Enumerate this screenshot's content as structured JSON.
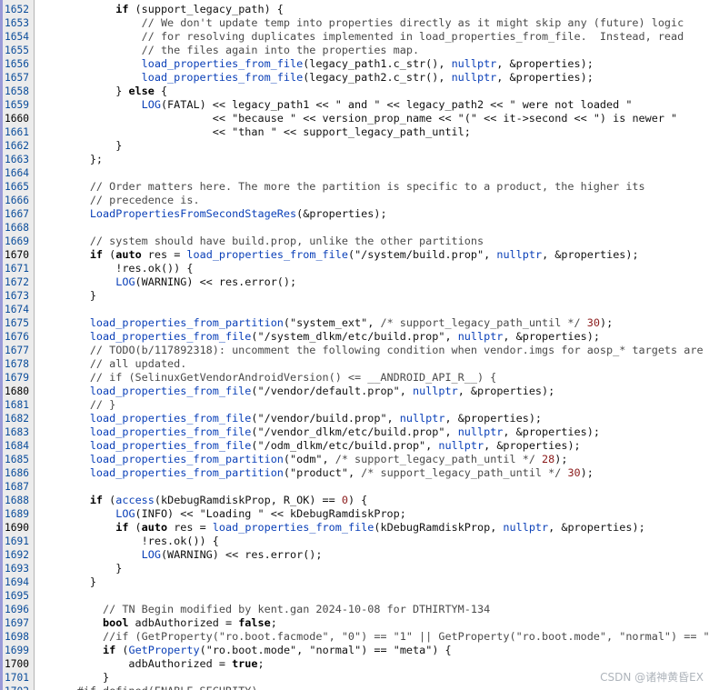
{
  "editor": {
    "lines": [
      {
        "n": "1651",
        "tokens": []
      },
      {
        "n": "1652",
        "tokens": [
          {
            "t": "            "
          },
          {
            "t": "if",
            "c": "kw"
          },
          {
            "t": " (support_legacy_path) {"
          }
        ]
      },
      {
        "n": "1653",
        "tokens": [
          {
            "t": "                "
          },
          {
            "t": "// We don't update temp into properties directly as it might skip any (future) logic",
            "c": "cm"
          }
        ]
      },
      {
        "n": "1654",
        "tokens": [
          {
            "t": "                "
          },
          {
            "t": "// for resolving duplicates implemented in load_properties_from_file.  Instead, read",
            "c": "cm"
          }
        ]
      },
      {
        "n": "1655",
        "tokens": [
          {
            "t": "                "
          },
          {
            "t": "// the files again into the properties map.",
            "c": "cm"
          }
        ]
      },
      {
        "n": "1656",
        "tokens": [
          {
            "t": "                "
          },
          {
            "t": "load_properties_from_file",
            "c": "fn"
          },
          {
            "t": "(legacy_path1.c_str(), "
          },
          {
            "t": "nullptr",
            "c": "fn"
          },
          {
            "t": ", &properties);"
          }
        ]
      },
      {
        "n": "1657",
        "tokens": [
          {
            "t": "                "
          },
          {
            "t": "load_properties_from_file",
            "c": "fn"
          },
          {
            "t": "(legacy_path2.c_str(), "
          },
          {
            "t": "nullptr",
            "c": "fn"
          },
          {
            "t": ", &properties);"
          }
        ]
      },
      {
        "n": "1658",
        "tokens": [
          {
            "t": "            } "
          },
          {
            "t": "else",
            "c": "kw"
          },
          {
            "t": " {"
          }
        ]
      },
      {
        "n": "1659",
        "tokens": [
          {
            "t": "                "
          },
          {
            "t": "LOG",
            "c": "fn"
          },
          {
            "t": "(FATAL) << legacy_path1 << "
          },
          {
            "t": "\" and \"",
            "c": "str"
          },
          {
            "t": " << legacy_path2 << "
          },
          {
            "t": "\" were not loaded \"",
            "c": "str"
          }
        ]
      },
      {
        "n": "1660",
        "cur": true,
        "tokens": [
          {
            "t": "                           << "
          },
          {
            "t": "\"because \"",
            "c": "str"
          },
          {
            "t": " << version_prop_name << "
          },
          {
            "t": "\"(\"",
            "c": "str"
          },
          {
            "t": " << it->second << "
          },
          {
            "t": "\") is newer \"",
            "c": "str"
          }
        ]
      },
      {
        "n": "1661",
        "tokens": [
          {
            "t": "                           << "
          },
          {
            "t": "\"than \"",
            "c": "str"
          },
          {
            "t": " << support_legacy_path_until;"
          }
        ]
      },
      {
        "n": "1662",
        "tokens": [
          {
            "t": "            }"
          }
        ]
      },
      {
        "n": "1663",
        "tokens": [
          {
            "t": "        };"
          }
        ]
      },
      {
        "n": "1664",
        "tokens": []
      },
      {
        "n": "1665",
        "tokens": [
          {
            "t": "        "
          },
          {
            "t": "// Order matters here. The more the partition is specific to a product, the higher its",
            "c": "cm"
          }
        ]
      },
      {
        "n": "1666",
        "tokens": [
          {
            "t": "        "
          },
          {
            "t": "// precedence is.",
            "c": "cm"
          }
        ]
      },
      {
        "n": "1667",
        "tokens": [
          {
            "t": "        "
          },
          {
            "t": "LoadPropertiesFromSecondStageRes",
            "c": "fn"
          },
          {
            "t": "(&properties);"
          }
        ]
      },
      {
        "n": "1668",
        "tokens": []
      },
      {
        "n": "1669",
        "tokens": [
          {
            "t": "        "
          },
          {
            "t": "// system should have build.prop, unlike the other partitions",
            "c": "cm"
          }
        ]
      },
      {
        "n": "1670",
        "cur": true,
        "tokens": [
          {
            "t": "        "
          },
          {
            "t": "if",
            "c": "kw"
          },
          {
            "t": " ("
          },
          {
            "t": "auto",
            "c": "kw"
          },
          {
            "t": " res = "
          },
          {
            "t": "load_properties_from_file",
            "c": "fn"
          },
          {
            "t": "("
          },
          {
            "t": "\"/system/build.prop\"",
            "c": "str"
          },
          {
            "t": ", "
          },
          {
            "t": "nullptr",
            "c": "fn"
          },
          {
            "t": ", &properties);"
          }
        ]
      },
      {
        "n": "1671",
        "tokens": [
          {
            "t": "            !res.ok()) {"
          }
        ]
      },
      {
        "n": "1672",
        "tokens": [
          {
            "t": "            "
          },
          {
            "t": "LOG",
            "c": "fn"
          },
          {
            "t": "(WARNING) << res.error();"
          }
        ]
      },
      {
        "n": "1673",
        "tokens": [
          {
            "t": "        }"
          }
        ]
      },
      {
        "n": "1674",
        "tokens": []
      },
      {
        "n": "1675",
        "tokens": [
          {
            "t": "        "
          },
          {
            "t": "load_properties_from_partition",
            "c": "fn"
          },
          {
            "t": "("
          },
          {
            "t": "\"system_ext\"",
            "c": "str"
          },
          {
            "t": ", "
          },
          {
            "t": "/* support_legacy_path_until */",
            "c": "cm"
          },
          {
            "t": " "
          },
          {
            "t": "30",
            "c": "num"
          },
          {
            "t": ");"
          }
        ]
      },
      {
        "n": "1676",
        "tokens": [
          {
            "t": "        "
          },
          {
            "t": "load_properties_from_file",
            "c": "fn"
          },
          {
            "t": "("
          },
          {
            "t": "\"/system_dlkm/etc/build.prop\"",
            "c": "str"
          },
          {
            "t": ", "
          },
          {
            "t": "nullptr",
            "c": "fn"
          },
          {
            "t": ", &properties);"
          }
        ]
      },
      {
        "n": "1677",
        "tokens": [
          {
            "t": "        "
          },
          {
            "t": "// TODO(b/117892318): uncomment the following condition when vendor.imgs for aosp_* targets are",
            "c": "cm"
          }
        ]
      },
      {
        "n": "1678",
        "tokens": [
          {
            "t": "        "
          },
          {
            "t": "// all updated.",
            "c": "cm"
          }
        ]
      },
      {
        "n": "1679",
        "tokens": [
          {
            "t": "        "
          },
          {
            "t": "// if (SelinuxGetVendorAndroidVersion() <= __ANDROID_API_R__) {",
            "c": "cm"
          }
        ]
      },
      {
        "n": "1680",
        "cur": true,
        "tokens": [
          {
            "t": "        "
          },
          {
            "t": "load_properties_from_file",
            "c": "fn"
          },
          {
            "t": "("
          },
          {
            "t": "\"/vendor/default.prop\"",
            "c": "str"
          },
          {
            "t": ", "
          },
          {
            "t": "nullptr",
            "c": "fn"
          },
          {
            "t": ", &properties);"
          }
        ]
      },
      {
        "n": "1681",
        "tokens": [
          {
            "t": "        "
          },
          {
            "t": "// }",
            "c": "cm"
          }
        ]
      },
      {
        "n": "1682",
        "tokens": [
          {
            "t": "        "
          },
          {
            "t": "load_properties_from_file",
            "c": "fn"
          },
          {
            "t": "("
          },
          {
            "t": "\"/vendor/build.prop\"",
            "c": "str"
          },
          {
            "t": ", "
          },
          {
            "t": "nullptr",
            "c": "fn"
          },
          {
            "t": ", &properties);"
          }
        ]
      },
      {
        "n": "1683",
        "tokens": [
          {
            "t": "        "
          },
          {
            "t": "load_properties_from_file",
            "c": "fn"
          },
          {
            "t": "("
          },
          {
            "t": "\"/vendor_dlkm/etc/build.prop\"",
            "c": "str"
          },
          {
            "t": ", "
          },
          {
            "t": "nullptr",
            "c": "fn"
          },
          {
            "t": ", &properties);"
          }
        ]
      },
      {
        "n": "1684",
        "tokens": [
          {
            "t": "        "
          },
          {
            "t": "load_properties_from_file",
            "c": "fn"
          },
          {
            "t": "("
          },
          {
            "t": "\"/odm_dlkm/etc/build.prop\"",
            "c": "str"
          },
          {
            "t": ", "
          },
          {
            "t": "nullptr",
            "c": "fn"
          },
          {
            "t": ", &properties);"
          }
        ]
      },
      {
        "n": "1685",
        "tokens": [
          {
            "t": "        "
          },
          {
            "t": "load_properties_from_partition",
            "c": "fn"
          },
          {
            "t": "("
          },
          {
            "t": "\"odm\"",
            "c": "str"
          },
          {
            "t": ", "
          },
          {
            "t": "/* support_legacy_path_until */",
            "c": "cm"
          },
          {
            "t": " "
          },
          {
            "t": "28",
            "c": "num"
          },
          {
            "t": ");"
          }
        ]
      },
      {
        "n": "1686",
        "tokens": [
          {
            "t": "        "
          },
          {
            "t": "load_properties_from_partition",
            "c": "fn"
          },
          {
            "t": "("
          },
          {
            "t": "\"product\"",
            "c": "str"
          },
          {
            "t": ", "
          },
          {
            "t": "/* support_legacy_path_until */",
            "c": "cm"
          },
          {
            "t": " "
          },
          {
            "t": "30",
            "c": "num"
          },
          {
            "t": ");"
          }
        ]
      },
      {
        "n": "1687",
        "tokens": []
      },
      {
        "n": "1688",
        "tokens": [
          {
            "t": "        "
          },
          {
            "t": "if",
            "c": "kw"
          },
          {
            "t": " ("
          },
          {
            "t": "access",
            "c": "fn"
          },
          {
            "t": "(kDebugRamdiskProp, R_OK) == "
          },
          {
            "t": "0",
            "c": "num"
          },
          {
            "t": ") {"
          }
        ]
      },
      {
        "n": "1689",
        "tokens": [
          {
            "t": "            "
          },
          {
            "t": "LOG",
            "c": "fn"
          },
          {
            "t": "(INFO) << "
          },
          {
            "t": "\"Loading \"",
            "c": "str"
          },
          {
            "t": " << kDebugRamdiskProp;"
          }
        ]
      },
      {
        "n": "1690",
        "cur": true,
        "tokens": [
          {
            "t": "            "
          },
          {
            "t": "if",
            "c": "kw"
          },
          {
            "t": " ("
          },
          {
            "t": "auto",
            "c": "kw"
          },
          {
            "t": " res = "
          },
          {
            "t": "load_properties_from_file",
            "c": "fn"
          },
          {
            "t": "(kDebugRamdiskProp, "
          },
          {
            "t": "nullptr",
            "c": "fn"
          },
          {
            "t": ", &properties);"
          }
        ]
      },
      {
        "n": "1691",
        "tokens": [
          {
            "t": "                !res.ok()) {"
          }
        ]
      },
      {
        "n": "1692",
        "tokens": [
          {
            "t": "                "
          },
          {
            "t": "LOG",
            "c": "fn"
          },
          {
            "t": "(WARNING) << res.error();"
          }
        ]
      },
      {
        "n": "1693",
        "tokens": [
          {
            "t": "            }"
          }
        ]
      },
      {
        "n": "1694",
        "tokens": [
          {
            "t": "        }"
          }
        ]
      },
      {
        "n": "1695",
        "tokens": []
      },
      {
        "n": "1696",
        "tokens": [
          {
            "t": "          "
          },
          {
            "t": "// TN Begin modified by kent.gan 2024-10-08 for DTHIRTYM-134",
            "c": "cm"
          }
        ]
      },
      {
        "n": "1697",
        "tokens": [
          {
            "t": "          "
          },
          {
            "t": "bool",
            "c": "kw"
          },
          {
            "t": " adbAuthorized = "
          },
          {
            "t": "false",
            "c": "kw"
          },
          {
            "t": ";"
          }
        ]
      },
      {
        "n": "1698",
        "tokens": [
          {
            "t": "          "
          },
          {
            "t": "//if (GetProperty(\"ro.boot.facmode\", \"0\") == \"1\" || GetProperty(\"ro.boot.mode\", \"normal\") == \"met",
            "c": "cm"
          }
        ]
      },
      {
        "n": "1699",
        "tokens": [
          {
            "t": "          "
          },
          {
            "t": "if",
            "c": "kw"
          },
          {
            "t": " ("
          },
          {
            "t": "GetProperty",
            "c": "fn"
          },
          {
            "t": "("
          },
          {
            "t": "\"ro.boot.mode\"",
            "c": "str"
          },
          {
            "t": ", "
          },
          {
            "t": "\"normal\"",
            "c": "str"
          },
          {
            "t": ") == "
          },
          {
            "t": "\"meta\"",
            "c": "str"
          },
          {
            "t": ") {"
          }
        ]
      },
      {
        "n": "1700",
        "cur": true,
        "tokens": [
          {
            "t": "              adbAuthorized = "
          },
          {
            "t": "true",
            "c": "kw"
          },
          {
            "t": ";"
          }
        ]
      },
      {
        "n": "1701",
        "tokens": [
          {
            "t": "          }"
          }
        ]
      },
      {
        "n": "1702",
        "tokens": [
          {
            "t": "      #if defined(ENABLE_SECURITY)",
            "c": "cm"
          }
        ]
      }
    ]
  },
  "watermark": "CSDN @诸神黄昏EX"
}
